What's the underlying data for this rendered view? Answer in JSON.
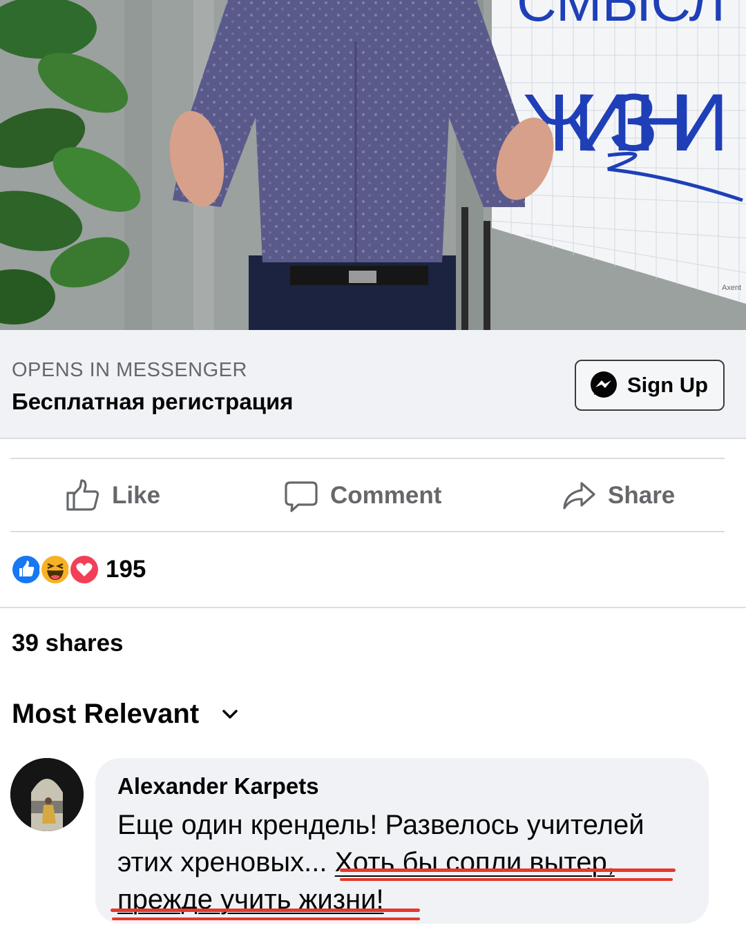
{
  "cta": {
    "caption": "OPENS IN MESSENGER",
    "title": "Бесплатная регистрация",
    "button_label": "Sign Up",
    "button_icon": "messenger-icon"
  },
  "actions": {
    "like": {
      "label": "Like",
      "icon": "thumbs-up-icon"
    },
    "comment": {
      "label": "Comment",
      "icon": "comment-bubble-icon"
    },
    "share": {
      "label": "Share",
      "icon": "share-arrow-icon"
    }
  },
  "reactions": {
    "types": [
      "like",
      "haha",
      "love"
    ],
    "count": "195",
    "colors": {
      "like": "#1877f2",
      "haha": "#f7b125",
      "love": "#f33e58"
    }
  },
  "shares": "39 shares",
  "sort": {
    "label": "Most Relevant",
    "icon": "chevron-down-icon"
  },
  "comment": {
    "author": "Alexander Karpets",
    "text_plain": "Еще один крендель! Развелось учителей этих хреновых... ",
    "text_highlighted": "Хоть бы сопли вытер, прежде учить жизни!",
    "highlight_color": "#e5382b"
  },
  "hero": {
    "board_text_top": "СМЫСЛ",
    "board_text": "ЖИЗНИ",
    "board_signature": "Axent"
  }
}
